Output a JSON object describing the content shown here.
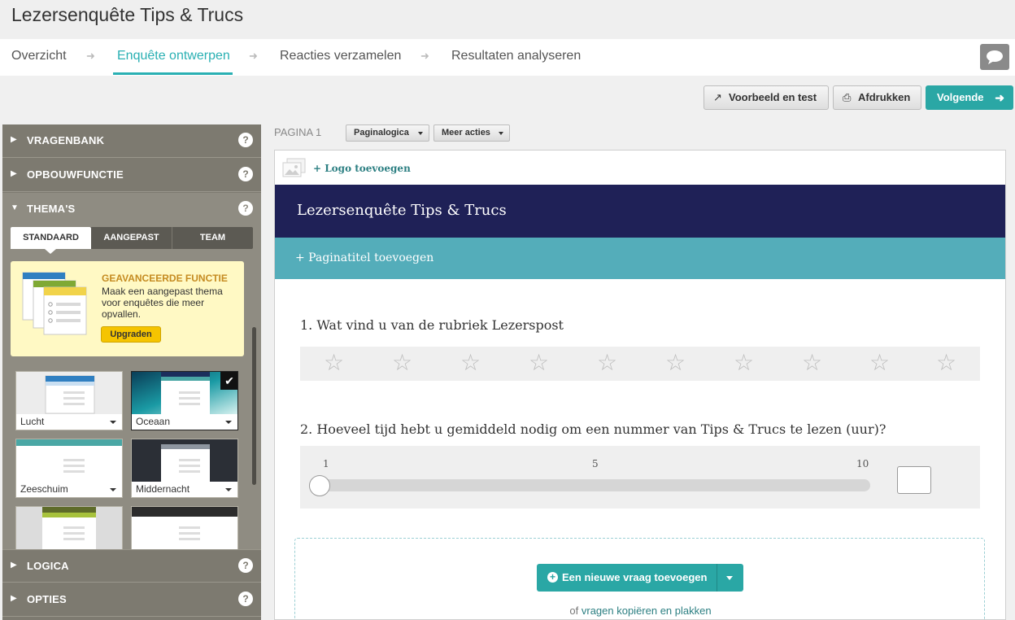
{
  "header": {
    "title": "Lezersenquête Tips & Trucs"
  },
  "nav": {
    "tabs": [
      {
        "label": "Overzicht"
      },
      {
        "label": "Enquête ontwerpen"
      },
      {
        "label": "Reacties verzamelen"
      },
      {
        "label": "Resultaten analyseren"
      }
    ],
    "arrow": "➜",
    "active_index": 1
  },
  "toolbar": {
    "preview_label": "Voorbeeld en test",
    "print_label": "Afdrukken",
    "next_label": "Volgende",
    "preview_icon": "share-icon",
    "print_icon": "printer-icon",
    "next_icon": "arrow-right-icon"
  },
  "sidebar": {
    "sections": [
      {
        "label": "VRAGENBANK"
      },
      {
        "label": "OPBOUWFUNCTIE"
      },
      {
        "label": "THEMA'S"
      },
      {
        "label": "LOGICA"
      },
      {
        "label": "OPTIES"
      }
    ],
    "help_glyph": "?",
    "theme_tabs": [
      {
        "label": "STANDAARD"
      },
      {
        "label": "AANGEPAST"
      },
      {
        "label": "TEAM"
      }
    ],
    "promo": {
      "title": "GEAVANCEERDE FUNCTIE",
      "text": "Maak een aangepast thema voor enquêtes die meer opvallen.",
      "button": "Upgraden"
    },
    "themes": [
      {
        "name": "Lucht",
        "accent": "#2f7fc1"
      },
      {
        "name": "Oceaan",
        "accent": "#1b3a6b",
        "selected": true
      },
      {
        "name": "Zeeschuim",
        "accent": "#4aa7a5"
      },
      {
        "name": "Middernacht",
        "accent": "#2b2f36"
      },
      {
        "name": "",
        "accent": "#7fa934"
      },
      {
        "name": "",
        "accent": "#2c2c2c"
      }
    ]
  },
  "page": {
    "label": "PAGINA 1",
    "logic_label": "Paginalogica",
    "more_label": "Meer acties"
  },
  "survey": {
    "logo_link": "+ Logo toevoegen",
    "title": "Lezersenquête Tips & Trucs",
    "page_title_link": "+ Paginatitel toevoegen",
    "colors": {
      "banner": "#1f2157",
      "band": "#54adba",
      "accent": "#2aa7a5"
    },
    "questions": [
      {
        "text": "1. Wat vind u van de rubriek Lezerspost",
        "type": "rating",
        "stars": 10
      },
      {
        "text": "2. Hoeveel tijd hebt u gemiddeld nodig om een nummer van Tips & Trucs te lezen (uur)?",
        "type": "slider",
        "min": "1",
        "mid": "5",
        "max": "10",
        "value": 1
      }
    ],
    "add_question_label": "Een nieuwe vraag toevoegen",
    "copy_prefix": "of",
    "copy_link": "vragen kopiëren en plakken"
  }
}
